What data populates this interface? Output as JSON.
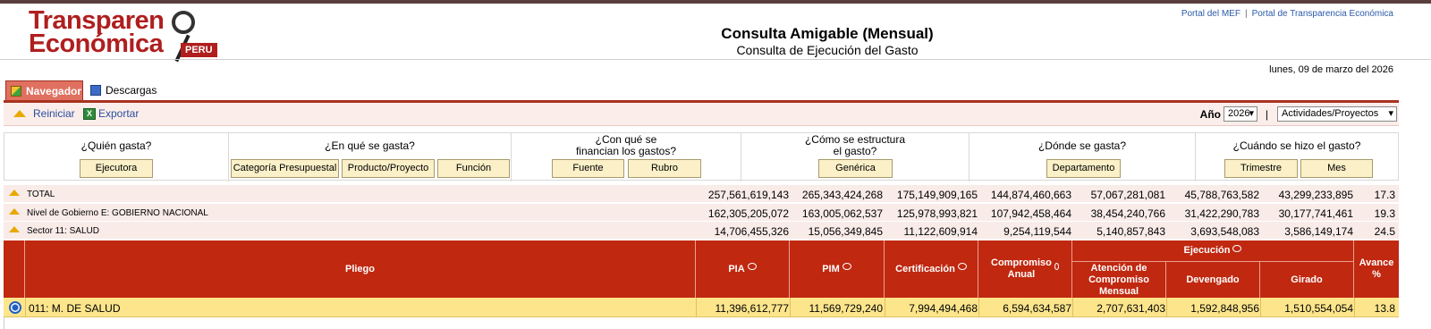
{
  "logo": {
    "line1": "Transparen",
    "line2": "Económica",
    "badge": "PERU",
    "name": "Transparencia Económica"
  },
  "toplinks": {
    "portal_mef": "Portal del MEF",
    "separator": "|",
    "portal_te": "Portal de Transparencia Económica"
  },
  "header": {
    "title": "Consulta Amigable (Mensual)",
    "subtitle": "Consulta de Ejecución del Gasto"
  },
  "date": "lunes, 09 de marzo del 2026",
  "tabs": [
    {
      "label": "Navegador",
      "icon": "cube-icon",
      "active": true
    },
    {
      "label": "Descargas",
      "icon": "monitor-icon",
      "active": false
    }
  ],
  "toolbar": {
    "reiniciar": "Reiniciar",
    "exportar": "Exportar",
    "anio_label": "Año",
    "anio_value": "2026",
    "pipe": "|",
    "vista_value": "Actividades/Proyectos"
  },
  "questions": [
    {
      "title": "¿Quién gasta?",
      "buttons": [
        "Ejecutora"
      ]
    },
    {
      "title": "¿En qué se gasta?",
      "buttons": [
        "Categoría Presupuestal",
        "Producto/Proyecto",
        "Función"
      ]
    },
    {
      "title": "¿Con qué se financian los gastos?",
      "buttons": [
        "Fuente",
        "Rubro"
      ]
    },
    {
      "title": "¿Cómo se estructura el gasto?",
      "buttons": [
        "Genérica"
      ]
    },
    {
      "title": "¿Dónde se gasta?",
      "buttons": [
        "Departamento"
      ]
    },
    {
      "title": "¿Cuándo se hizo el gasto?",
      "buttons": [
        "Trimestre",
        "Mes"
      ]
    }
  ],
  "summary_rows": [
    {
      "label": "TOTAL",
      "values": [
        "257,561,619,143",
        "265,343,424,268",
        "175,149,909,165",
        "144,874,460,663",
        "57,067,281,081",
        "45,788,763,582",
        "43,299,233,895",
        "17.3"
      ]
    },
    {
      "label": "Nivel de Gobierno E: GOBIERNO NACIONAL",
      "values": [
        "162,305,205,072",
        "163,005,062,537",
        "125,978,993,821",
        "107,942,458,464",
        "38,454,240,766",
        "31,422,290,783",
        "30,177,741,461",
        "19.3"
      ]
    },
    {
      "label": "Sector 11: SALUD",
      "values": [
        "14,706,455,326",
        "15,056,349,845",
        "11,122,609,914",
        "9,254,119,544",
        "5,140,857,843",
        "3,693,548,083",
        "3,586,149,174",
        "24.5"
      ]
    }
  ],
  "table": {
    "headers": {
      "pliego": "Pliego",
      "pia": "PIA",
      "pim": "PIM",
      "certificacion": "Certificación",
      "compromiso": "Compromiso Anual",
      "ejecucion": "Ejecución",
      "atencion": "Atención de Compromiso Mensual",
      "devengado": "Devengado",
      "girado": "Girado",
      "avance": "Avance %"
    },
    "rows": [
      {
        "label": "011: M. DE SALUD",
        "values": [
          "11,396,612,777",
          "11,569,729,240",
          "7,994,494,468",
          "6,594,634,587",
          "2,707,631,403",
          "1,592,848,956",
          "1,510,554,054",
          "13.8"
        ]
      }
    ]
  }
}
